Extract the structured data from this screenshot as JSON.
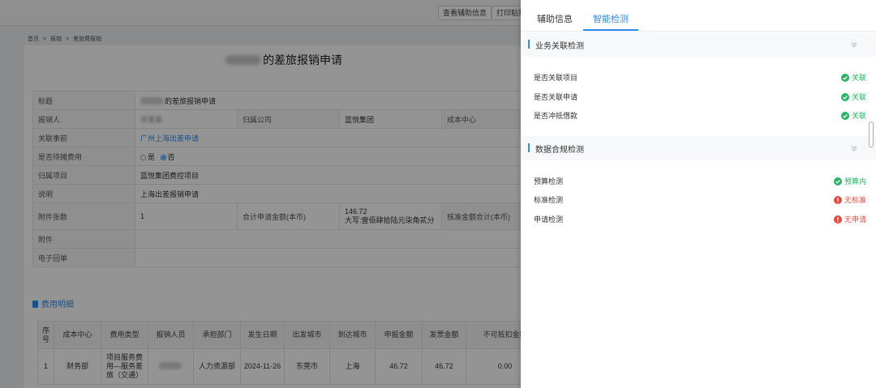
{
  "toolbar": {
    "aux_info_button": "查看辅助信息",
    "print_button": "打印粘贴"
  },
  "breadcrumb": [
    "首页",
    ">",
    "报销",
    ">",
    "差旅费报销"
  ],
  "form": {
    "title_suffix": "的差旅报销申请",
    "rows": {
      "title_label": "标题",
      "title_value": "的差旅报销申请",
      "applicant_label": "报销人",
      "applicant_value": "李某某",
      "company_label": "归属公司",
      "company_value": "蓝悦集团",
      "cost_center_label": "成本中心",
      "related_label": "关联事前",
      "related_value": "广州上海出差申请",
      "share_label": "是否待摊费用",
      "share_yes": "是",
      "share_no": "否",
      "project_label": "归属项目",
      "project_value": "蓝悦集团费控项目",
      "desc_label": "说明",
      "desc_value": "上海出差报销申请",
      "attach_count_label": "附件张数",
      "attach_count_value": "1",
      "total_label": "合计申请金额(本币)",
      "total_value": "146.72",
      "total_upper": "大写:壹佰肆拾陆元柒角贰分",
      "standard_label": "核准金额合计(本币)",
      "attachment_label": "附件",
      "e_receipt_label": "电子回单"
    }
  },
  "expense": {
    "section_title": "费用明细",
    "headers": [
      "序号",
      "成本中心",
      "费用类型",
      "报销人员",
      "承担部门",
      "发生日期",
      "出发城市",
      "到达城市",
      "申报金额",
      "发票金额",
      "不可抵扣金额"
    ],
    "row": {
      "no": "1",
      "cost_center": "财务部",
      "type": "项目服务费用—服务差旅（交通）",
      "dept": "人力资源部",
      "date": "2024-11-26",
      "from": "东莞市",
      "to": "上海",
      "declared": "46.72",
      "invoice": "46.72",
      "non_deductible": "0.00"
    }
  },
  "drawer": {
    "tabs": [
      {
        "label": "辅助信息"
      },
      {
        "label": "智能检测"
      }
    ],
    "groups": [
      {
        "title": "业务关联检测",
        "items": [
          {
            "label": "是否关联项目",
            "status": "关联"
          },
          {
            "label": "是否关联申请",
            "status": "关联"
          },
          {
            "label": "是否冲抵借款",
            "status": "关联"
          }
        ]
      },
      {
        "title": "数据合规检测",
        "items": [
          {
            "label": "预算检测",
            "status": "预算内"
          },
          {
            "label": "标准检测",
            "status": "无标准"
          },
          {
            "label": "申请检测",
            "status": "无申请"
          }
        ]
      }
    ]
  },
  "colors": {
    "accent": "#2d8cf0",
    "ok": "#28b463",
    "error": "#e34b3d"
  }
}
